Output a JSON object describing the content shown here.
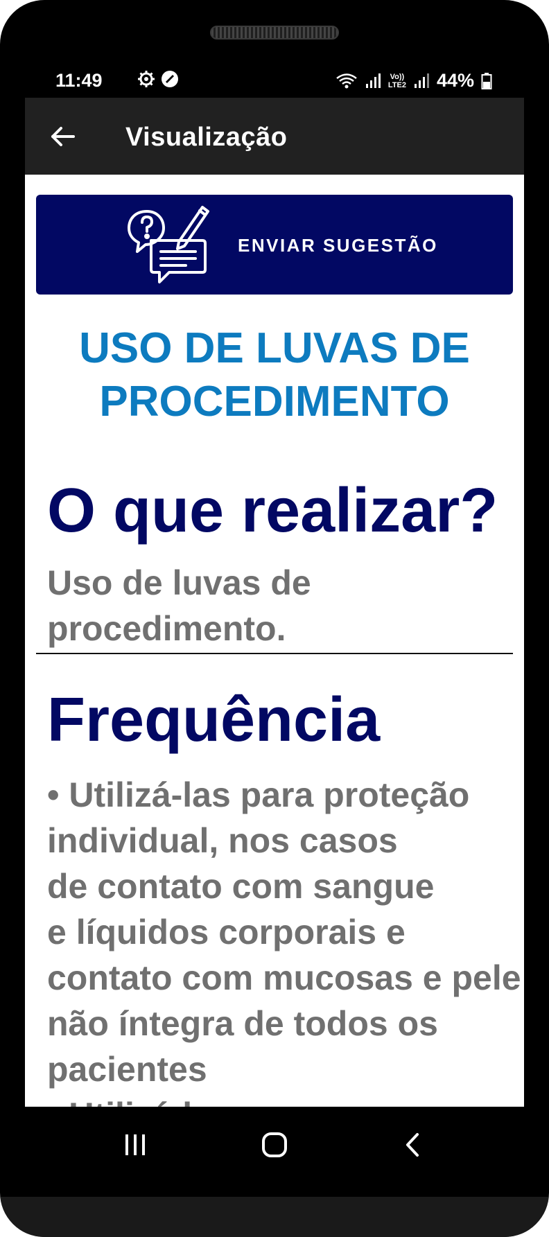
{
  "status": {
    "time": "11:49",
    "battery": "44%",
    "icons_left": [
      "settings-icon",
      "app-notification-icon"
    ],
    "icons_right": [
      "wifi-icon",
      "signal-icon",
      "volte-icon",
      "signal-icon-2",
      "battery-icon"
    ],
    "volte_label_top": "Vo))",
    "volte_label_bottom": "LTE2"
  },
  "appbar": {
    "title": "Visualização",
    "back_icon": "arrow-left-icon"
  },
  "suggest_button": {
    "label": "ENVIAR SUGESTÃO",
    "icon": "question-form-icon",
    "color": "#020863"
  },
  "main_title": "USO DE LUVAS DE PROCEDIMENTO",
  "sections": [
    {
      "heading": "O que realizar?",
      "text": "Uso de luvas de procedimento."
    },
    {
      "heading": "Frequência",
      "text": "• Utilizá-las para proteção individual, nos casos\nde contato com sangue\ne líquidos corporais e contato com mucosas e pele não íntegra de todos os pacientes\n• Utilizá-las"
    }
  ],
  "nav": {
    "recent_icon": "recent-apps-icon",
    "home_icon": "home-icon",
    "back_icon": "back-chevron-icon"
  },
  "colors": {
    "title_blue": "#0d7bbf",
    "heading_navy": "#020863",
    "body_gray": "#707070",
    "appbar_bg": "#212121"
  }
}
